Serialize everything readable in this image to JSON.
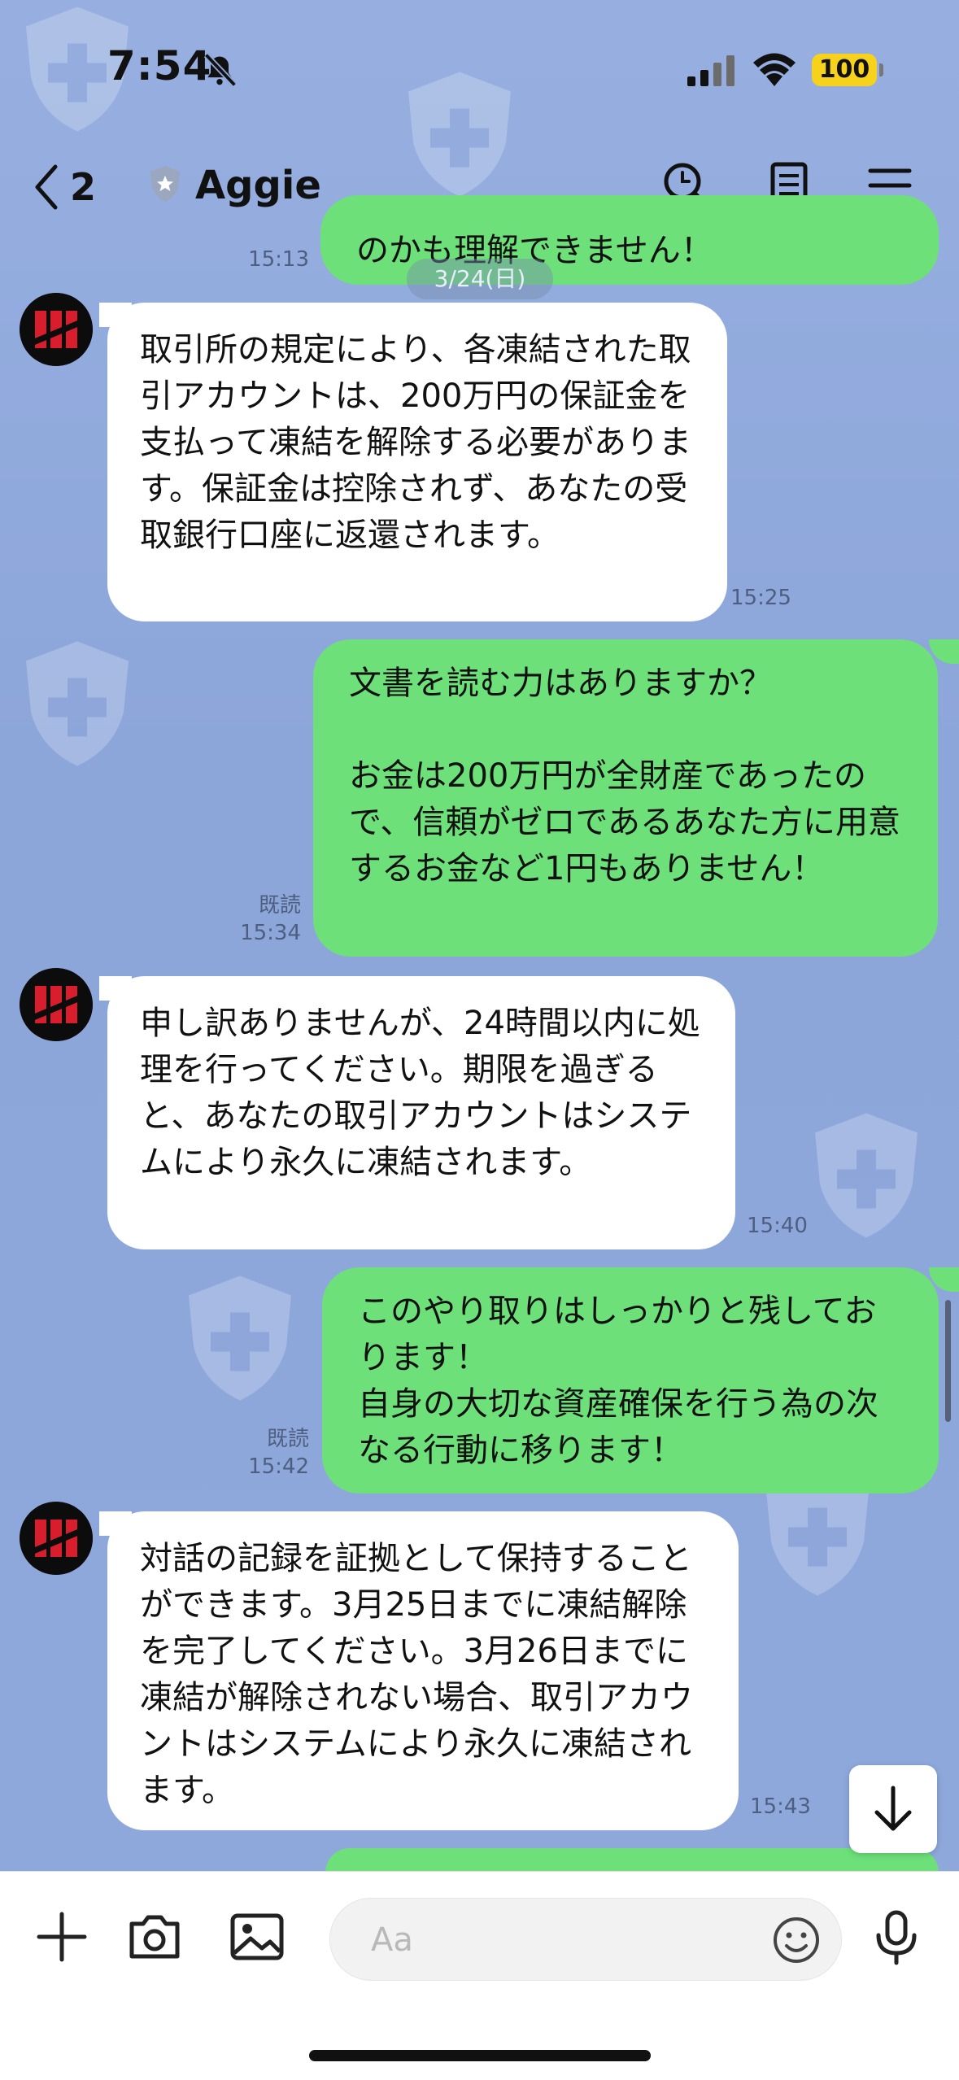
{
  "status_bar": {
    "time": "7:54",
    "battery": "100",
    "icons": [
      "bell-slash-icon",
      "cellular-signal-icon",
      "wifi-icon",
      "battery-icon"
    ]
  },
  "header": {
    "back_count": "2",
    "chat_name": "Aggie",
    "icons": [
      "chevron-left-icon",
      "shield-badge-icon",
      "search-icon",
      "notes-icon",
      "menu-icon"
    ]
  },
  "date_separator": "3/24(日)",
  "top_partial": {
    "meta_time": "15:13",
    "text": "のかも理解できません！"
  },
  "messages": [
    {
      "direction": "in",
      "time": "15:25",
      "text": "取引所の規定により、各凍結された取引アカウントは、200万円の保証金を支払って凍結を解除する必要があります。保証金は控除されず、あなたの受取銀行口座に返還されます。"
    },
    {
      "direction": "out",
      "read": "既読",
      "time": "15:34",
      "text": "文書を読む力はありますか？\n\nお金は200万円が全財産であったので、信頼がゼロであるあなた方に用意するお金など1円もありません！"
    },
    {
      "direction": "in",
      "time": "15:40",
      "text": "申し訳ありませんが、24時間以内に処理を行ってください。期限を過ぎると、あなたの取引アカウントはシステムにより永久に凍結されます。"
    },
    {
      "direction": "out",
      "read": "既読",
      "time": "15:42",
      "text": "このやり取りはしっかりと残しております！\n自身の大切な資産確保を行う為の次なる行動に移ります！"
    },
    {
      "direction": "in",
      "time": "15:43",
      "text": "対話の記録を証拠として保持することができます。3月25日までに凍結解除を完了してください。3月26日までに凍結が解除されない場合、取引アカウントはシステムにより永久に凍結されます。"
    }
  ],
  "input_bar": {
    "placeholder": "Aa",
    "icons": [
      "plus-icon",
      "camera-icon",
      "image-icon",
      "emoji-icon",
      "microphone-icon"
    ]
  },
  "colors": {
    "background": "#8ea6d8",
    "incoming_bubble": "#ffffff",
    "outgoing_bubble": "#6de07a",
    "battery": "#f7d21d"
  }
}
